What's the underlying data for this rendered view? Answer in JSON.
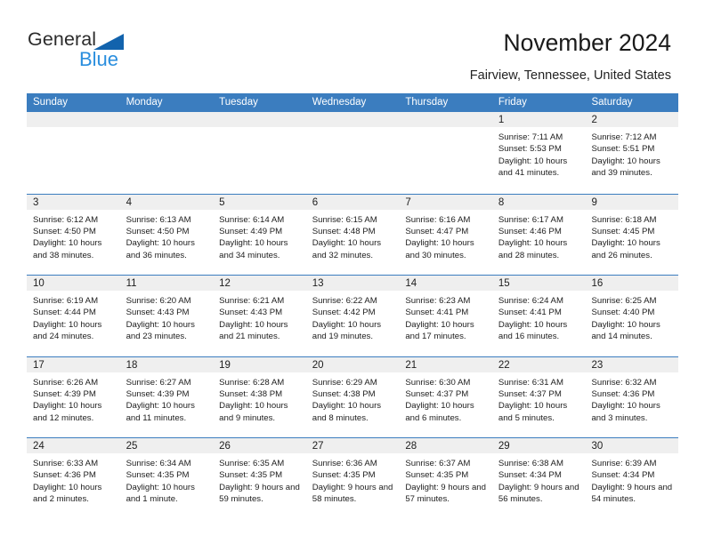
{
  "brand": {
    "name_part1": "General",
    "name_part2": "Blue",
    "triangle_color": "#1263ad",
    "blue_color": "#2a8ede"
  },
  "header": {
    "title": "November 2024",
    "subtitle": "Fairview, Tennessee, United States"
  },
  "calendar": {
    "accent_color": "#3b7dbf",
    "day_band_color": "#efefef",
    "weekdays": [
      "Sunday",
      "Monday",
      "Tuesday",
      "Wednesday",
      "Thursday",
      "Friday",
      "Saturday"
    ],
    "weeks": [
      [
        {
          "day": "",
          "sunrise": "",
          "sunset": "",
          "daylight": "",
          "empty": true
        },
        {
          "day": "",
          "sunrise": "",
          "sunset": "",
          "daylight": "",
          "empty": true
        },
        {
          "day": "",
          "sunrise": "",
          "sunset": "",
          "daylight": "",
          "empty": true
        },
        {
          "day": "",
          "sunrise": "",
          "sunset": "",
          "daylight": "",
          "empty": true
        },
        {
          "day": "",
          "sunrise": "",
          "sunset": "",
          "daylight": "",
          "empty": true
        },
        {
          "day": "1",
          "sunrise": "Sunrise: 7:11 AM",
          "sunset": "Sunset: 5:53 PM",
          "daylight": "Daylight: 10 hours and 41 minutes.",
          "empty": false
        },
        {
          "day": "2",
          "sunrise": "Sunrise: 7:12 AM",
          "sunset": "Sunset: 5:51 PM",
          "daylight": "Daylight: 10 hours and 39 minutes.",
          "empty": false
        }
      ],
      [
        {
          "day": "3",
          "sunrise": "Sunrise: 6:12 AM",
          "sunset": "Sunset: 4:50 PM",
          "daylight": "Daylight: 10 hours and 38 minutes.",
          "empty": false
        },
        {
          "day": "4",
          "sunrise": "Sunrise: 6:13 AM",
          "sunset": "Sunset: 4:50 PM",
          "daylight": "Daylight: 10 hours and 36 minutes.",
          "empty": false
        },
        {
          "day": "5",
          "sunrise": "Sunrise: 6:14 AM",
          "sunset": "Sunset: 4:49 PM",
          "daylight": "Daylight: 10 hours and 34 minutes.",
          "empty": false
        },
        {
          "day": "6",
          "sunrise": "Sunrise: 6:15 AM",
          "sunset": "Sunset: 4:48 PM",
          "daylight": "Daylight: 10 hours and 32 minutes.",
          "empty": false
        },
        {
          "day": "7",
          "sunrise": "Sunrise: 6:16 AM",
          "sunset": "Sunset: 4:47 PM",
          "daylight": "Daylight: 10 hours and 30 minutes.",
          "empty": false
        },
        {
          "day": "8",
          "sunrise": "Sunrise: 6:17 AM",
          "sunset": "Sunset: 4:46 PM",
          "daylight": "Daylight: 10 hours and 28 minutes.",
          "empty": false
        },
        {
          "day": "9",
          "sunrise": "Sunrise: 6:18 AM",
          "sunset": "Sunset: 4:45 PM",
          "daylight": "Daylight: 10 hours and 26 minutes.",
          "empty": false
        }
      ],
      [
        {
          "day": "10",
          "sunrise": "Sunrise: 6:19 AM",
          "sunset": "Sunset: 4:44 PM",
          "daylight": "Daylight: 10 hours and 24 minutes.",
          "empty": false
        },
        {
          "day": "11",
          "sunrise": "Sunrise: 6:20 AM",
          "sunset": "Sunset: 4:43 PM",
          "daylight": "Daylight: 10 hours and 23 minutes.",
          "empty": false
        },
        {
          "day": "12",
          "sunrise": "Sunrise: 6:21 AM",
          "sunset": "Sunset: 4:43 PM",
          "daylight": "Daylight: 10 hours and 21 minutes.",
          "empty": false
        },
        {
          "day": "13",
          "sunrise": "Sunrise: 6:22 AM",
          "sunset": "Sunset: 4:42 PM",
          "daylight": "Daylight: 10 hours and 19 minutes.",
          "empty": false
        },
        {
          "day": "14",
          "sunrise": "Sunrise: 6:23 AM",
          "sunset": "Sunset: 4:41 PM",
          "daylight": "Daylight: 10 hours and 17 minutes.",
          "empty": false
        },
        {
          "day": "15",
          "sunrise": "Sunrise: 6:24 AM",
          "sunset": "Sunset: 4:41 PM",
          "daylight": "Daylight: 10 hours and 16 minutes.",
          "empty": false
        },
        {
          "day": "16",
          "sunrise": "Sunrise: 6:25 AM",
          "sunset": "Sunset: 4:40 PM",
          "daylight": "Daylight: 10 hours and 14 minutes.",
          "empty": false
        }
      ],
      [
        {
          "day": "17",
          "sunrise": "Sunrise: 6:26 AM",
          "sunset": "Sunset: 4:39 PM",
          "daylight": "Daylight: 10 hours and 12 minutes.",
          "empty": false
        },
        {
          "day": "18",
          "sunrise": "Sunrise: 6:27 AM",
          "sunset": "Sunset: 4:39 PM",
          "daylight": "Daylight: 10 hours and 11 minutes.",
          "empty": false
        },
        {
          "day": "19",
          "sunrise": "Sunrise: 6:28 AM",
          "sunset": "Sunset: 4:38 PM",
          "daylight": "Daylight: 10 hours and 9 minutes.",
          "empty": false
        },
        {
          "day": "20",
          "sunrise": "Sunrise: 6:29 AM",
          "sunset": "Sunset: 4:38 PM",
          "daylight": "Daylight: 10 hours and 8 minutes.",
          "empty": false
        },
        {
          "day": "21",
          "sunrise": "Sunrise: 6:30 AM",
          "sunset": "Sunset: 4:37 PM",
          "daylight": "Daylight: 10 hours and 6 minutes.",
          "empty": false
        },
        {
          "day": "22",
          "sunrise": "Sunrise: 6:31 AM",
          "sunset": "Sunset: 4:37 PM",
          "daylight": "Daylight: 10 hours and 5 minutes.",
          "empty": false
        },
        {
          "day": "23",
          "sunrise": "Sunrise: 6:32 AM",
          "sunset": "Sunset: 4:36 PM",
          "daylight": "Daylight: 10 hours and 3 minutes.",
          "empty": false
        }
      ],
      [
        {
          "day": "24",
          "sunrise": "Sunrise: 6:33 AM",
          "sunset": "Sunset: 4:36 PM",
          "daylight": "Daylight: 10 hours and 2 minutes.",
          "empty": false
        },
        {
          "day": "25",
          "sunrise": "Sunrise: 6:34 AM",
          "sunset": "Sunset: 4:35 PM",
          "daylight": "Daylight: 10 hours and 1 minute.",
          "empty": false
        },
        {
          "day": "26",
          "sunrise": "Sunrise: 6:35 AM",
          "sunset": "Sunset: 4:35 PM",
          "daylight": "Daylight: 9 hours and 59 minutes.",
          "empty": false
        },
        {
          "day": "27",
          "sunrise": "Sunrise: 6:36 AM",
          "sunset": "Sunset: 4:35 PM",
          "daylight": "Daylight: 9 hours and 58 minutes.",
          "empty": false
        },
        {
          "day": "28",
          "sunrise": "Sunrise: 6:37 AM",
          "sunset": "Sunset: 4:35 PM",
          "daylight": "Daylight: 9 hours and 57 minutes.",
          "empty": false
        },
        {
          "day": "29",
          "sunrise": "Sunrise: 6:38 AM",
          "sunset": "Sunset: 4:34 PM",
          "daylight": "Daylight: 9 hours and 56 minutes.",
          "empty": false
        },
        {
          "day": "30",
          "sunrise": "Sunrise: 6:39 AM",
          "sunset": "Sunset: 4:34 PM",
          "daylight": "Daylight: 9 hours and 54 minutes.",
          "empty": false
        }
      ]
    ]
  }
}
